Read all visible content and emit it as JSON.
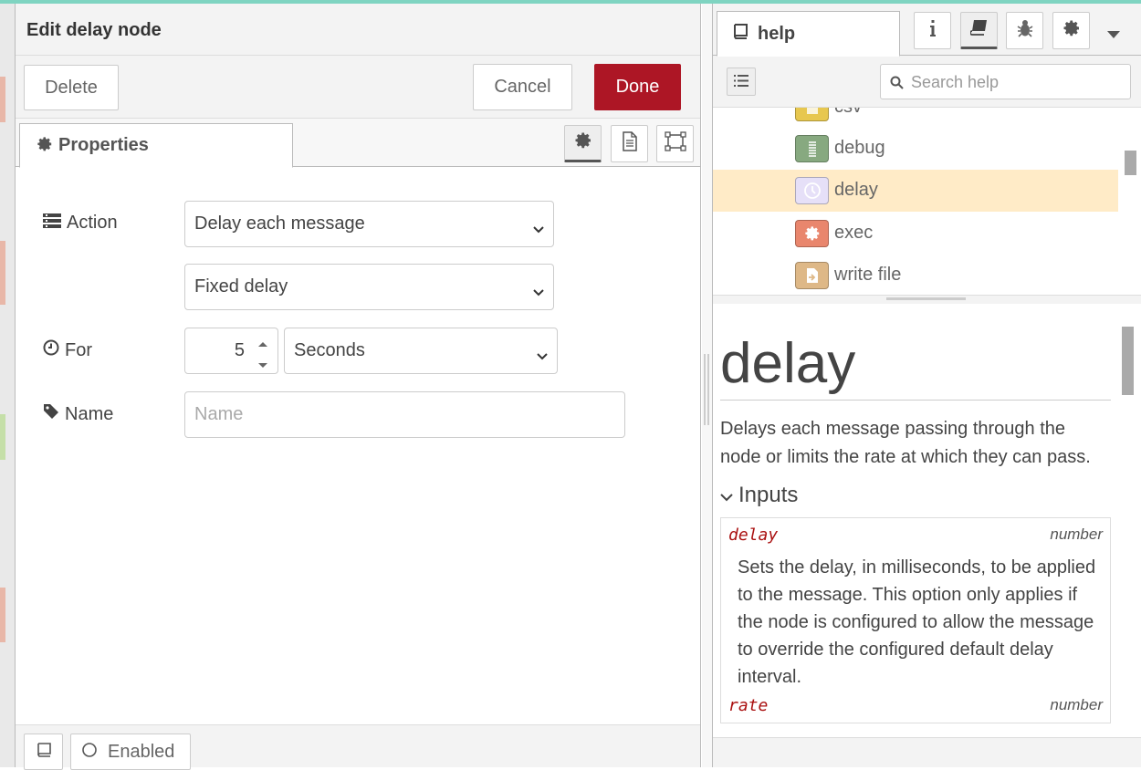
{
  "editor": {
    "title": "Edit delay node",
    "delete_label": "Delete",
    "cancel_label": "Cancel",
    "done_label": "Done",
    "tab_properties": "Properties",
    "action_label": "Action",
    "action_value": "Delay each message",
    "delay_type_value": "Fixed delay",
    "for_label": "For",
    "for_value": "5",
    "for_units": "Seconds",
    "name_label": "Name",
    "name_placeholder": "Name",
    "enabled_label": "Enabled"
  },
  "sidebar": {
    "tab_label": "help",
    "search_placeholder": "Search help",
    "tree": [
      {
        "label": "csv",
        "color": "#e7c74f"
      },
      {
        "label": "debug",
        "color": "#87a980"
      },
      {
        "label": "delay",
        "color": "#e6e0f8",
        "selected": true
      },
      {
        "label": "exec",
        "color": "#e9866d"
      },
      {
        "label": "write file",
        "color": "#deb887"
      }
    ],
    "doc": {
      "title": "delay",
      "description": "Delays each message passing through the node or limits the rate at which they can pass.",
      "inputs_heading": "Inputs",
      "props": [
        {
          "name": "delay",
          "type": "number",
          "desc": "Sets the delay, in milliseconds, to be applied to the message. This option only applies if the node is configured to allow the message to override the configured default delay interval."
        },
        {
          "name": "rate",
          "type": "number",
          "desc": ""
        }
      ]
    }
  },
  "colors": {
    "accent": "#ad1625",
    "selected_row": "#ffebc7"
  }
}
